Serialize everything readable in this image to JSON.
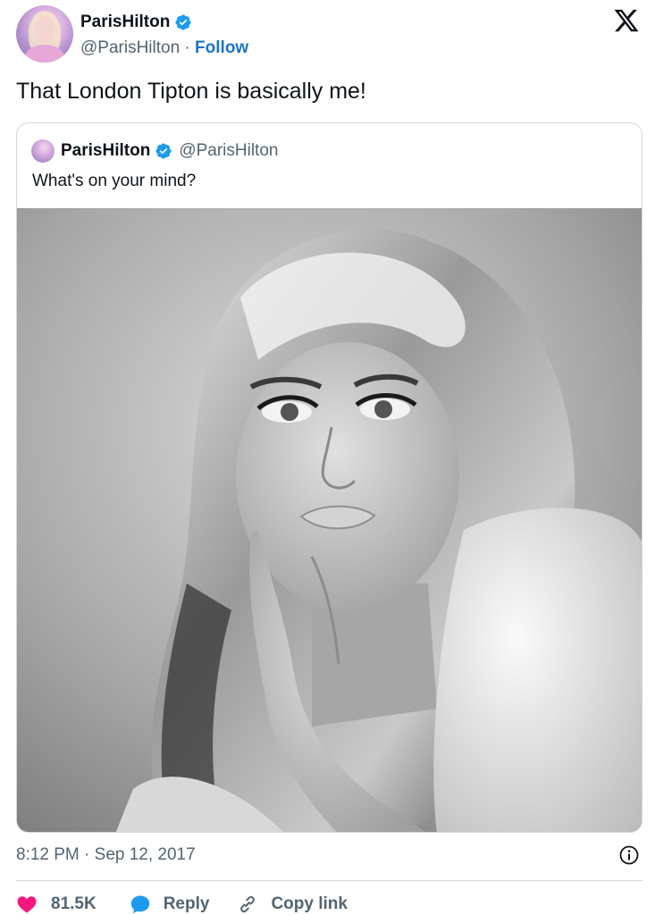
{
  "author": {
    "display_name": "ParisHilton",
    "handle": "@ParisHilton",
    "separator": " · ",
    "follow_label": "Follow"
  },
  "tweet": {
    "text": "That London Tipton is basically me!",
    "timestamp": "8:12 PM · Sep 12, 2017"
  },
  "quoted_tweet": {
    "display_name": "ParisHilton",
    "handle": "@ParisHilton",
    "text": "What's on your mind?"
  },
  "actions": {
    "likes": "81.5K",
    "reply_label": "Reply",
    "copy_link_label": "Copy link"
  },
  "icons": {
    "verified": "verified-badge-icon",
    "logo": "x-logo-icon",
    "info": "info-icon",
    "like": "heart-icon",
    "reply": "speech-bubble-icon",
    "copy": "link-icon"
  },
  "colors": {
    "verified": "#1d9bf0",
    "follow": "#1d74c8",
    "heart": "#f91880",
    "reply": "#1d9bf0",
    "muted": "#536471",
    "text": "#0f1419"
  }
}
